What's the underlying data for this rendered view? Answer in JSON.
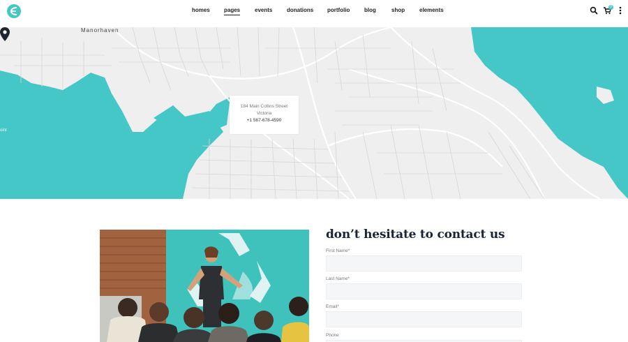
{
  "header": {
    "logo": "e-logo-icon",
    "nav": [
      {
        "label": "homes",
        "active": false
      },
      {
        "label": "pages",
        "active": true
      },
      {
        "label": "events",
        "active": false
      },
      {
        "label": "donations",
        "active": false
      },
      {
        "label": "portfolio",
        "active": false
      },
      {
        "label": "blog",
        "active": false
      },
      {
        "label": "shop",
        "active": false
      },
      {
        "label": "elements",
        "active": false
      }
    ],
    "icons": [
      "search-icon",
      "cart-icon",
      "more-vertical-icon"
    ],
    "cart_count": "0",
    "accent_color": "#45c7c8"
  },
  "map": {
    "town_label": "Manorhaven",
    "point_label": "oint",
    "water_color": "#45c7c8",
    "land_color": "#efefef",
    "popup": {
      "address_line1": "184 Main Collins Street",
      "address_line2": "Victoria",
      "phone": "+1 567-678-4590"
    },
    "pin_icon": "map-pin-icon"
  },
  "contact": {
    "title": "don’t hesitate to contact us",
    "fields": [
      {
        "label": "First Name*",
        "value": ""
      },
      {
        "label": "Last Name*",
        "value": ""
      },
      {
        "label": "Email*",
        "value": ""
      },
      {
        "label": "Phone",
        "value": ""
      }
    ]
  }
}
